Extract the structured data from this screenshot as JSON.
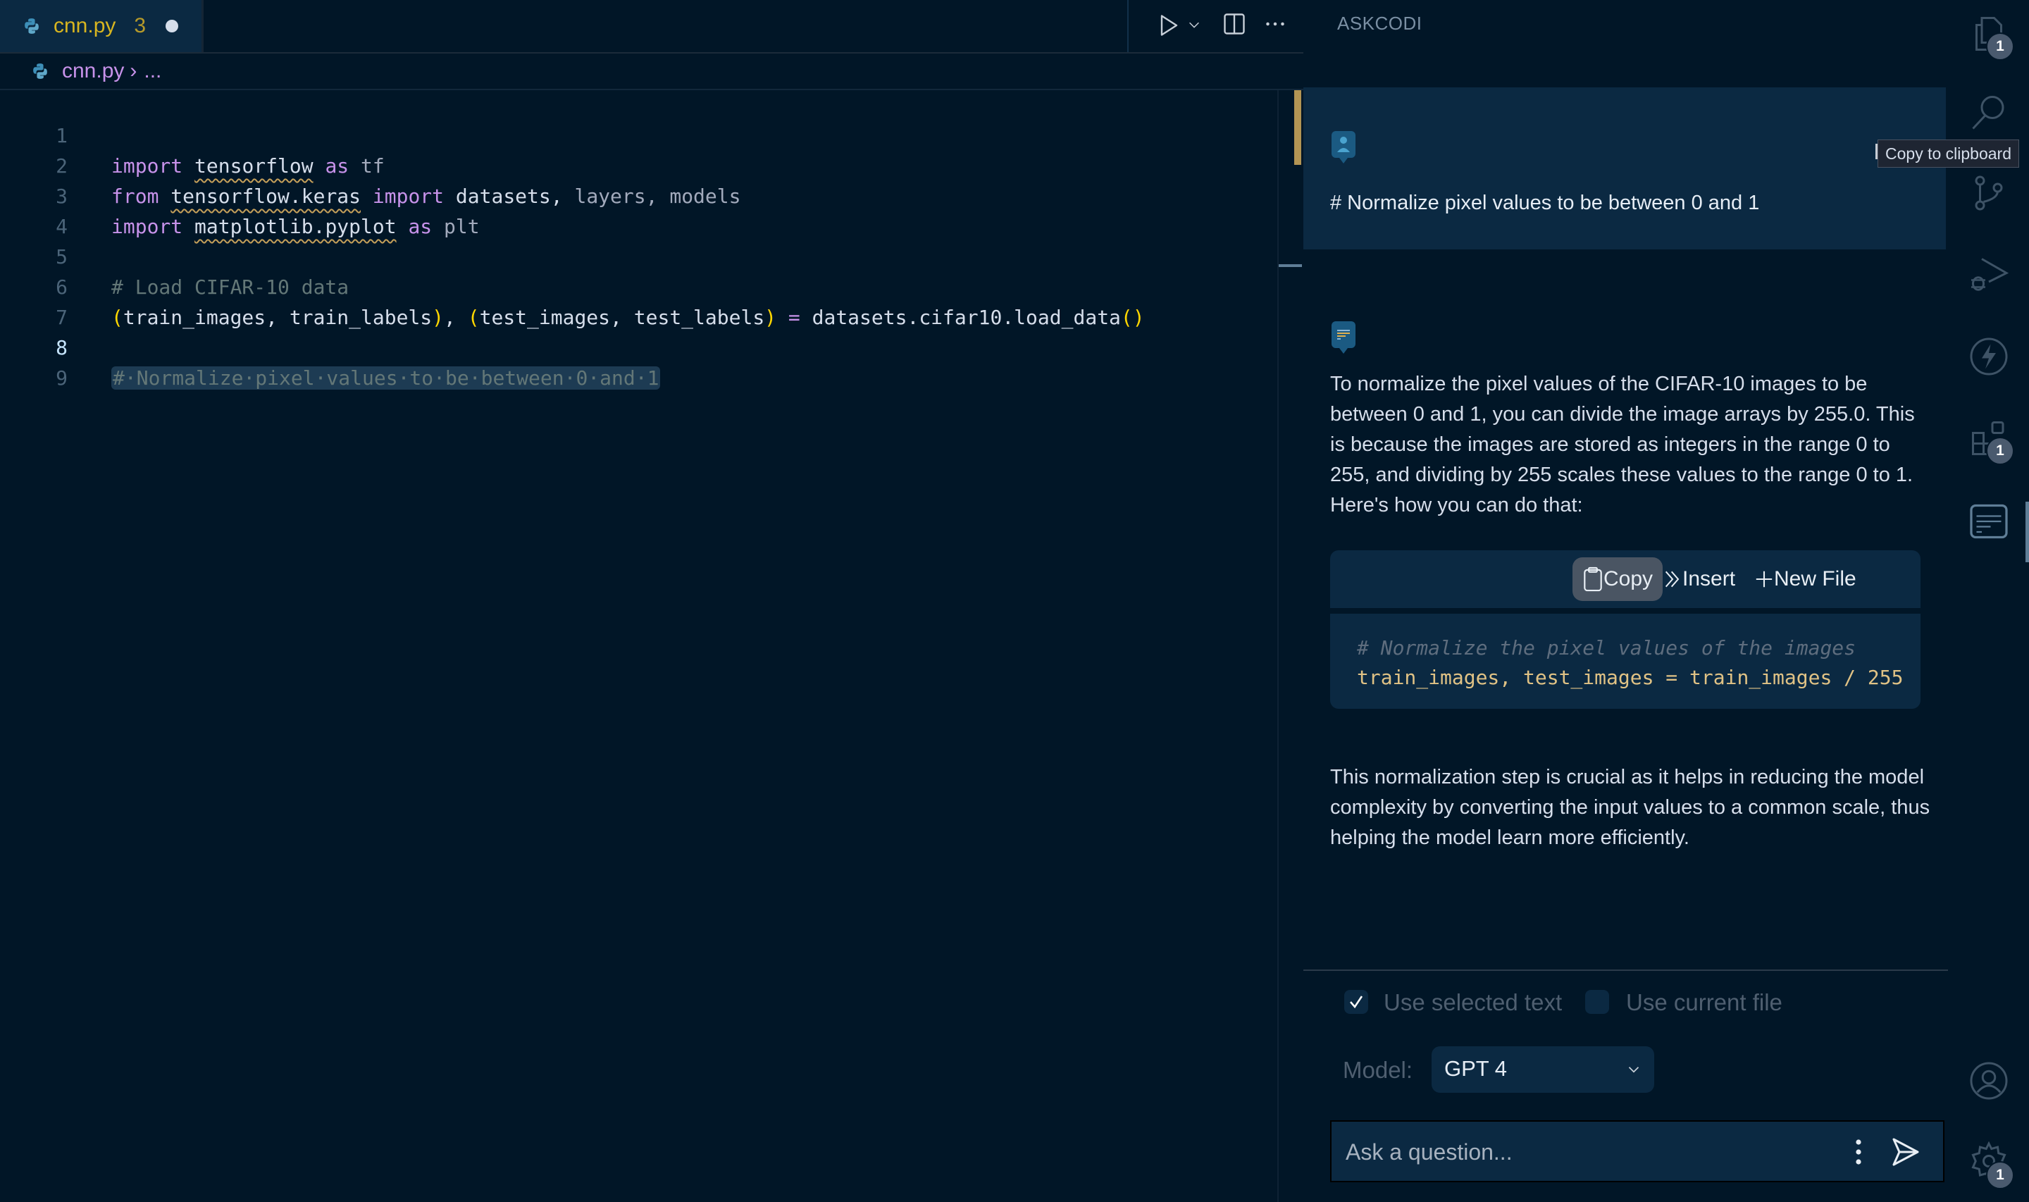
{
  "editor": {
    "tab": {
      "file_name": "cnn.py",
      "problem_count": "3",
      "modified_icon": "dot-modified-icon"
    },
    "actions": {
      "run": "run-icon",
      "run_dropdown": "chevron-down-icon",
      "split": "split-editor-icon",
      "more": "more-actions-icon"
    },
    "breadcrumb": {
      "file": "cnn.py",
      "separator": "›",
      "more": "..."
    },
    "lines": [
      {
        "num": "1"
      },
      {
        "num": "2"
      },
      {
        "num": "3"
      },
      {
        "num": "4"
      },
      {
        "num": "5"
      },
      {
        "num": "6"
      },
      {
        "num": "7"
      },
      {
        "num": "8"
      },
      {
        "num": "9"
      }
    ],
    "code": {
      "l1": {
        "kw1": "import",
        "mod": "tensorflow",
        "kw2": "as",
        "alias": "tf"
      },
      "l2": {
        "kw1": "from",
        "mod": "tensorflow.keras",
        "kw2": "import",
        "n1": "datasets,",
        "n2": "layers,",
        "n3": "models"
      },
      "l3": {
        "kw1": "import",
        "mod": "matplotlib.pyplot",
        "kw2": "as",
        "alias": "plt"
      },
      "l5": {
        "comment": "# Load CIFAR-10 data"
      },
      "l6": {
        "p1": "(",
        "a": "train_images, train_labels",
        "p2": ")",
        "comma": ", ",
        "p3": "(",
        "b": "test_images, test_labels",
        "p4": ")",
        "eq": " = ",
        "call": "datasets.cifar10.load_data",
        "p5": "()"
      },
      "l8": {
        "comment": "#·Normalize·pixel·values·to·be·between·0·and·1"
      }
    }
  },
  "panel": {
    "title": "ASKCODI",
    "user_message": "# Normalize pixel values to be between 0 and 1",
    "assistant_intro": "To normalize the pixel values of the CIFAR-10 images to be between 0 and 1, you can divide the image arrays by 255.0. This is because the images are stored as integers in the range 0 to 255, and dividing by 255 scales these values to the range 0 to 1. Here's how you can do that:",
    "code_block": {
      "buttons": {
        "copy": "Copy",
        "insert": "Insert",
        "new_file": "New File"
      },
      "comment": "# Normalize the pixel values of the images",
      "code": "train_images, test_images = train_images / 255"
    },
    "assistant_outro": "This normalization step is crucial as it helps in reducing the model complexity by converting the input values to a common scale, thus helping the model learn more efficiently.",
    "options": {
      "use_selected_text": {
        "label": "Use selected text",
        "checked": true
      },
      "use_current_file": {
        "label": "Use current file",
        "checked": false
      }
    },
    "model": {
      "label": "Model:",
      "selected": "GPT 4"
    },
    "ask": {
      "placeholder": "Ask a question...",
      "value": ""
    },
    "tooltip": "Copy to clipboard"
  },
  "activity_bar": {
    "items": [
      {
        "name": "explorer-icon",
        "badge": "1"
      },
      {
        "name": "search-icon",
        "badge": ""
      },
      {
        "name": "source-control-icon",
        "badge": ""
      },
      {
        "name": "run-debug-icon",
        "badge": ""
      },
      {
        "name": "lightning-icon",
        "badge": ""
      },
      {
        "name": "extensions-icon",
        "badge": "1"
      },
      {
        "name": "askcodi-icon",
        "badge": ""
      },
      {
        "name": "account-icon",
        "badge": ""
      },
      {
        "name": "settings-gear-icon",
        "badge": "1"
      }
    ]
  },
  "colors": {
    "background": "#011627",
    "panel_highlight": "#0b2942",
    "keyword": "#c792ea",
    "tab_name": "#d8b520",
    "bracket": "#ffd700",
    "comment": "#637777",
    "code_snippet": "#e0c285"
  }
}
